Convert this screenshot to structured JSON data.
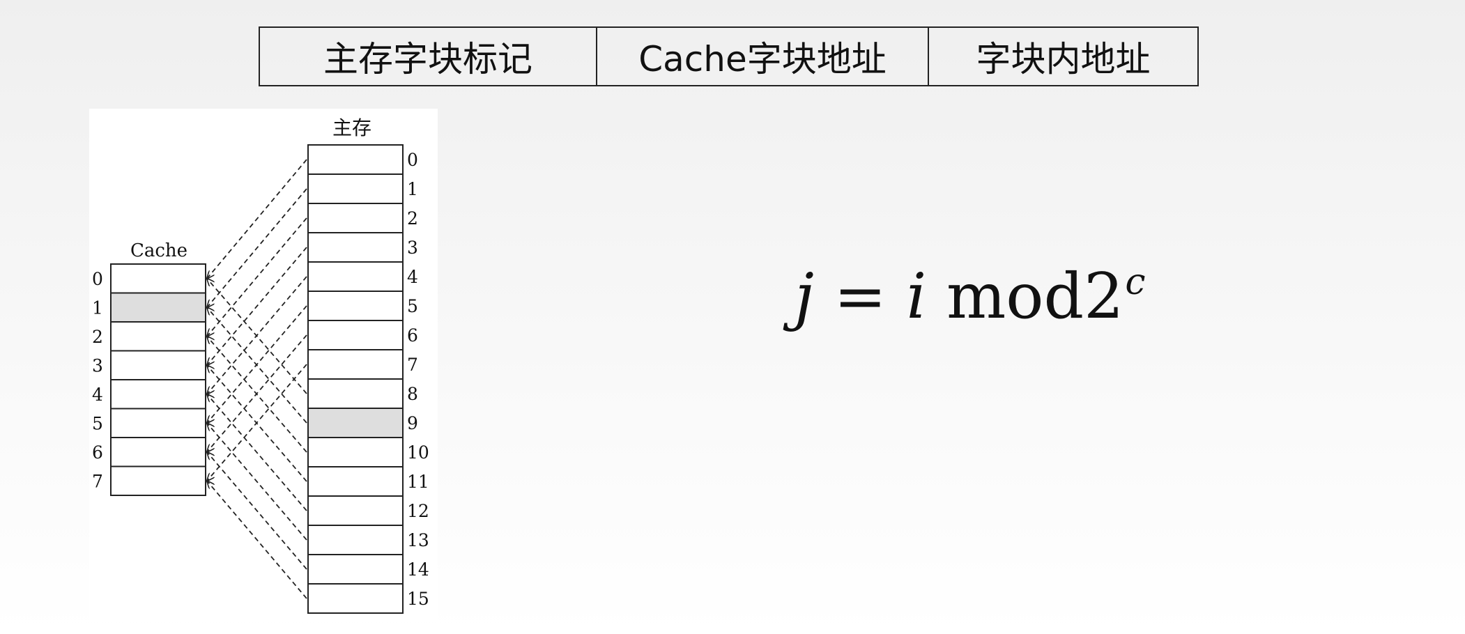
{
  "address_format": {
    "fields": [
      "主存字块标记",
      "Cache字块地址",
      "字块内地址"
    ]
  },
  "diagram": {
    "main_memory": {
      "title": "主存",
      "block_labels": [
        "0",
        "1",
        "2",
        "3",
        "4",
        "5",
        "6",
        "7",
        "8",
        "9",
        "10",
        "11",
        "12",
        "13",
        "14",
        "15"
      ],
      "highlighted_block": 9
    },
    "cache": {
      "title": "Cache",
      "block_labels": [
        "0",
        "1",
        "2",
        "3",
        "4",
        "5",
        "6",
        "7"
      ],
      "highlighted_block": 1
    },
    "mapping": "direct",
    "line_style": "dashed"
  },
  "formula": {
    "lhs": "j",
    "equals": "=",
    "var": "i",
    "op": "mod",
    "base": "2",
    "exponent": "c"
  },
  "colors": {
    "highlight_fill": "#dedede",
    "stroke": "#222222"
  }
}
